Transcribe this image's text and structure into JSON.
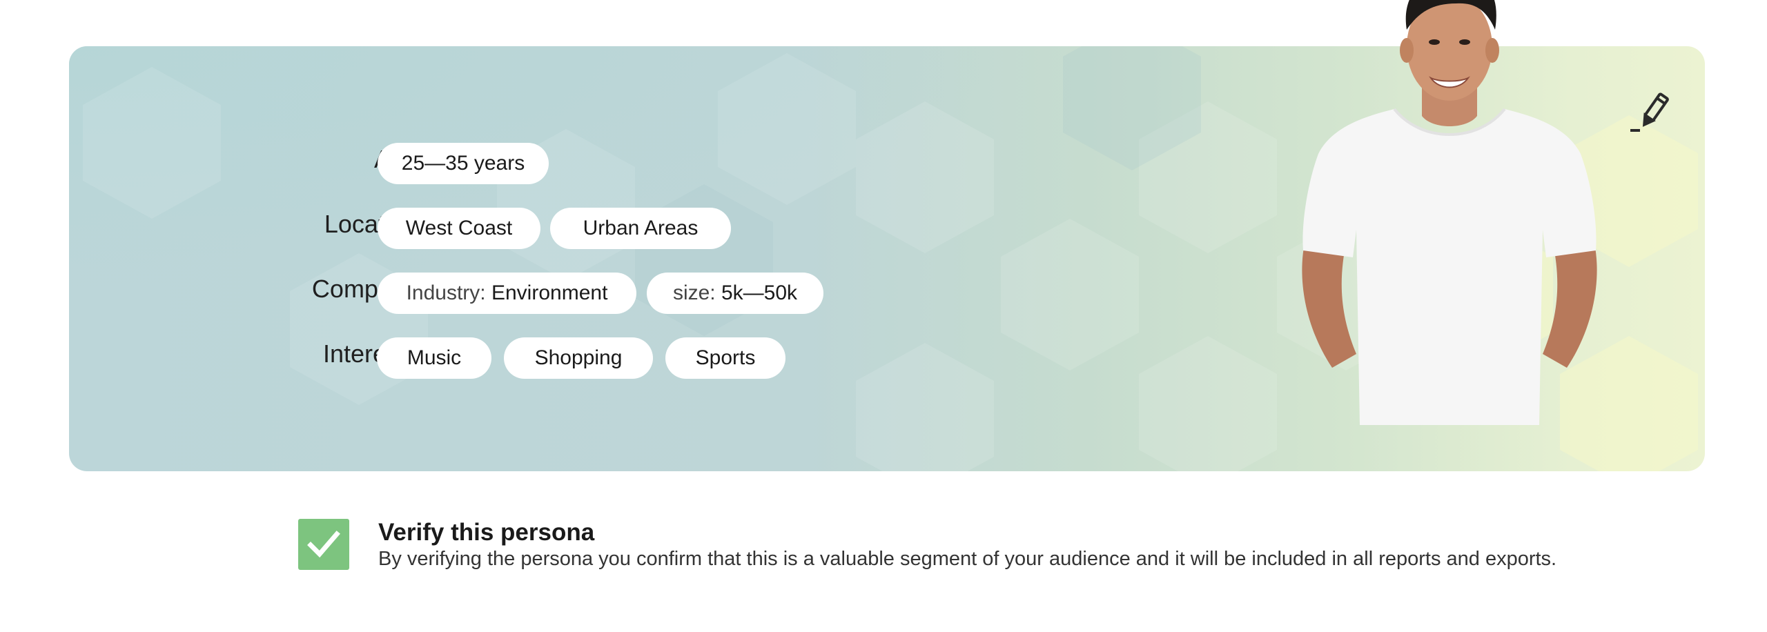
{
  "persona": {
    "rows": {
      "age": {
        "label": "Age:",
        "value": "25—35 years"
      },
      "location": {
        "label": "Location:",
        "values": [
          "West Coast",
          "Urban Areas"
        ]
      },
      "company": {
        "label": "Company:",
        "industry_prefix": "Industry:",
        "industry_value": "Environment",
        "size_prefix": "size:",
        "size_value": "5k—50k"
      },
      "interests": {
        "label": "Interests:",
        "values": [
          "Music",
          "Shopping",
          "Sports"
        ]
      }
    },
    "edit_icon": "pencil-edit-icon",
    "photo": "smiling-man-white-tshirt"
  },
  "verify": {
    "title": "Verify this persona",
    "description": "By verifying the persona you confirm that this is a valuable segment of your audience and it will be included in all reports and exports.",
    "checked": true,
    "check_color": "#7dc47f"
  },
  "colors": {
    "card_left": "#bcd6d9",
    "card_right": "#ecf3d2",
    "pill_bg": "#ffffff"
  }
}
